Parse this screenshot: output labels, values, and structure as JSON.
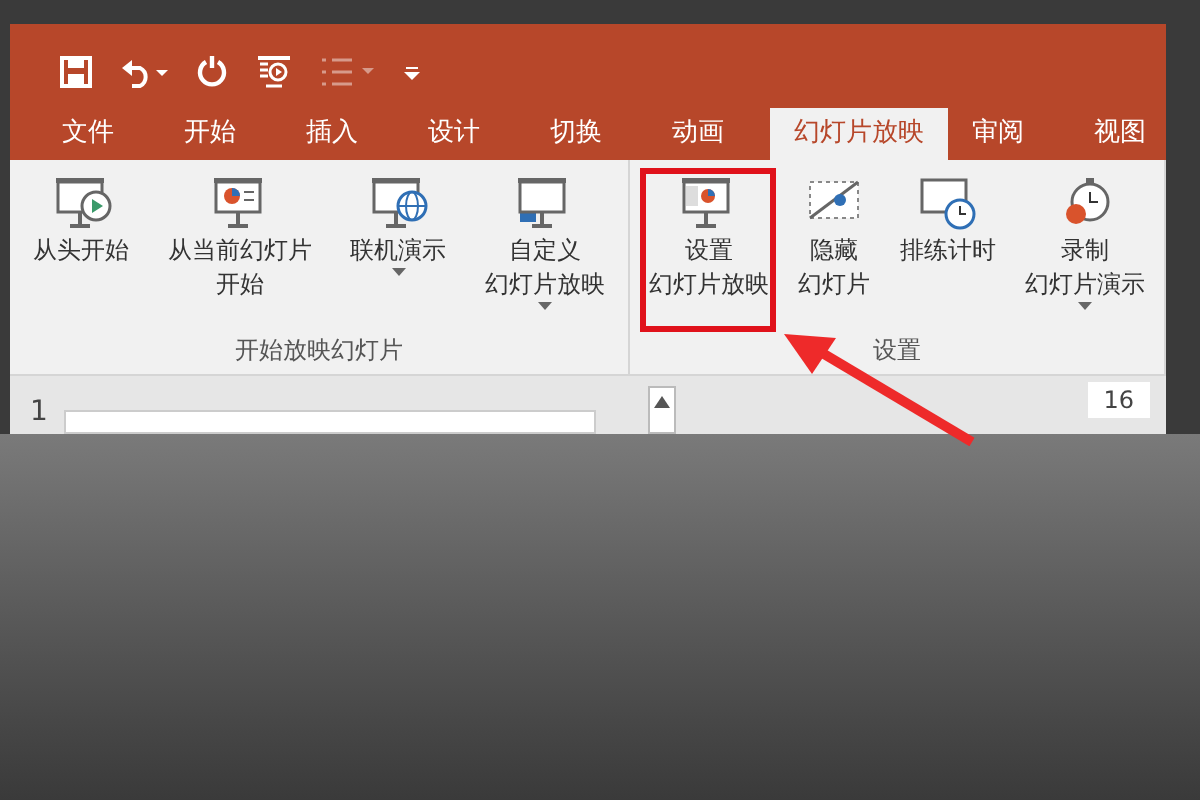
{
  "tabs": [
    {
      "label": "文件",
      "selected": false
    },
    {
      "label": "开始",
      "selected": false
    },
    {
      "label": "插入",
      "selected": false
    },
    {
      "label": "设计",
      "selected": false
    },
    {
      "label": "切换",
      "selected": false
    },
    {
      "label": "动画",
      "selected": false
    },
    {
      "label": "幻灯片放映",
      "selected": true
    },
    {
      "label": "审阅",
      "selected": false
    },
    {
      "label": "视图",
      "selected": false
    }
  ],
  "groups": [
    {
      "label": "开始放映幻灯片",
      "buttons": [
        {
          "kind": "play",
          "lines": [
            "从头开始"
          ],
          "dropdown": false,
          "highlighted": false
        },
        {
          "kind": "current",
          "lines": [
            "从当前幻灯片",
            "开始"
          ],
          "dropdown": false,
          "highlighted": false
        },
        {
          "kind": "online",
          "lines": [
            "联机演示"
          ],
          "dropdown": true,
          "highlighted": false
        },
        {
          "kind": "custom",
          "lines": [
            "自定义",
            "幻灯片放映"
          ],
          "dropdown": true,
          "highlighted": false
        }
      ]
    },
    {
      "label": "设置",
      "buttons": [
        {
          "kind": "setup",
          "lines": [
            "设置",
            "幻灯片放映"
          ],
          "dropdown": false,
          "highlighted": true
        },
        {
          "kind": "hide",
          "lines": [
            "隐藏",
            "幻灯片"
          ],
          "dropdown": false,
          "highlighted": false
        },
        {
          "kind": "timing",
          "lines": [
            "排练计时"
          ],
          "dropdown": false,
          "highlighted": false
        },
        {
          "kind": "record",
          "lines": [
            "录制",
            "幻灯片演示"
          ],
          "dropdown": true,
          "highlighted": false
        }
      ]
    }
  ],
  "slide_pane": {
    "number": "1"
  },
  "ruler": {
    "mark": "16"
  }
}
